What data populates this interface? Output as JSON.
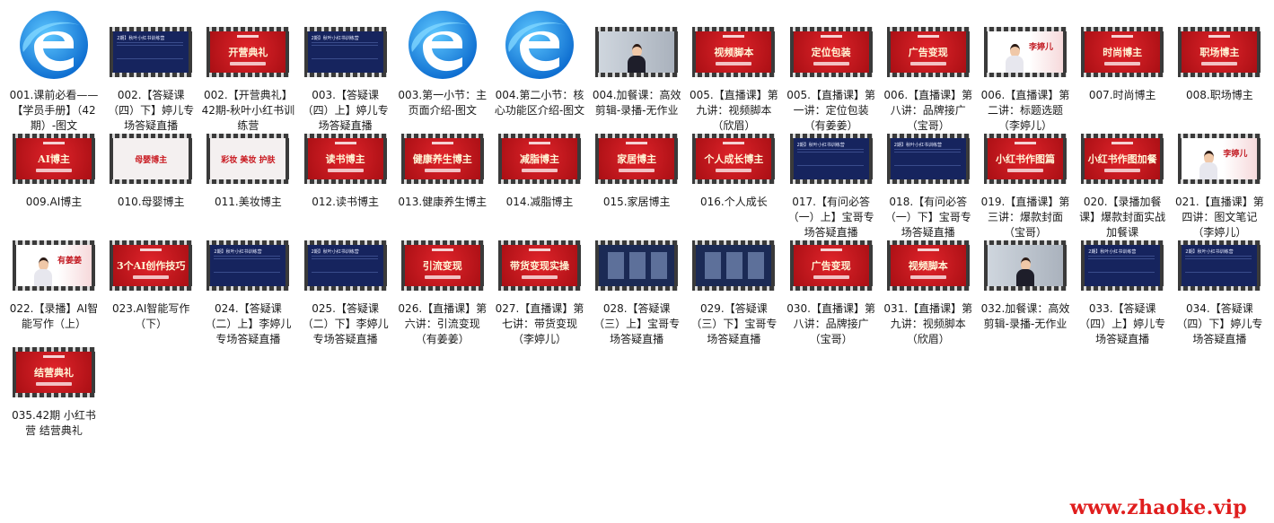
{
  "items": [
    {
      "label": "001.课前必看——【学员手册】（42期）-图文",
      "kind": "edge",
      "thumb": ""
    },
    {
      "label": "002.【答疑课（四）下】婷儿专场答疑直播",
      "kind": "navy",
      "thumb": "2期】秋叶小红书训练营"
    },
    {
      "label": "002.【开营典礼】42期-秋叶小红书训练营",
      "kind": "red",
      "thumb": "开营典礼"
    },
    {
      "label": "003.【答疑课（四）上】婷儿专场答疑直播",
      "kind": "navy",
      "thumb": "2期】秋叶小红书训练营"
    },
    {
      "label": "003.第一小节：主页面介绍-图文",
      "kind": "edge",
      "thumb": ""
    },
    {
      "label": "004.第二小节：核心功能区介绍-图文",
      "kind": "edge",
      "thumb": ""
    },
    {
      "label": "004.加餐课：高效剪辑-录播-无作业",
      "kind": "person",
      "thumb": ""
    },
    {
      "label": "005.【直播课】第九讲：视频脚本（欣眉）",
      "kind": "red",
      "thumb": "视频脚本"
    },
    {
      "label": "005.【直播课】第一讲：定位包装（有姜姜）",
      "kind": "red",
      "thumb": "定位包装"
    },
    {
      "label": "006.【直播课】第八讲：品牌接广（宝哥）",
      "kind": "red",
      "thumb": "广告变现"
    },
    {
      "label": "006.【直播课】第二讲：标题选题（李婷儿）",
      "kind": "pink",
      "thumb": "李婷儿"
    },
    {
      "label": "007.时尚博主",
      "kind": "red",
      "thumb": "时尚博主"
    },
    {
      "label": "008.职场博主",
      "kind": "red",
      "thumb": "职场博主"
    },
    {
      "label": "009.AI博主",
      "kind": "red",
      "thumb": "AI博主"
    },
    {
      "label": "010.母婴博主",
      "kind": "white",
      "thumb": "母婴博主"
    },
    {
      "label": "011.美妆博主",
      "kind": "white",
      "thumb": "彩妆 美妆 护肤"
    },
    {
      "label": "012.读书博主",
      "kind": "red",
      "thumb": "读书博主"
    },
    {
      "label": "013.健康养生博主",
      "kind": "red",
      "thumb": "健康养生博主"
    },
    {
      "label": "014.减脂博主",
      "kind": "red",
      "thumb": "减脂博主"
    },
    {
      "label": "015.家居博主",
      "kind": "red",
      "thumb": "家居博主"
    },
    {
      "label": "016.个人成长",
      "kind": "red",
      "thumb": "个人成长博主"
    },
    {
      "label": "017.【有问必答（一）上】宝哥专场答疑直播",
      "kind": "navy",
      "thumb": "2期】秋叶小红书训练营"
    },
    {
      "label": "018.【有问必答（一）下】宝哥专场答疑直播",
      "kind": "navy",
      "thumb": "2期】秋叶小红书训练营"
    },
    {
      "label": "019.【直播课】第三讲：爆款封面（宝哥）",
      "kind": "red",
      "thumb": "小红书作图篇"
    },
    {
      "label": "020.【录播加餐课】爆款封面实战加餐课",
      "kind": "red",
      "thumb": "小红书作图加餐"
    },
    {
      "label": "021.【直播课】第四讲：图文笔记（李婷儿）",
      "kind": "pink",
      "thumb": "李婷儿"
    },
    {
      "label": "022.【录播】AI智能写作（上）",
      "kind": "pink",
      "thumb": "有姜姜"
    },
    {
      "label": "023.AI智能写作（下）",
      "kind": "red",
      "thumb": "3个AI创作技巧"
    },
    {
      "label": "024.【答疑课（二）上】李婷儿专场答疑直播",
      "kind": "navy",
      "thumb": "2期】秋叶小红书训练营"
    },
    {
      "label": "025.【答疑课（二）下】李婷儿专场答疑直播",
      "kind": "navy",
      "thumb": "2期】秋叶小红书训练营"
    },
    {
      "label": "026.【直播课】第六讲：引流变现（有姜姜）",
      "kind": "red",
      "thumb": "引流变现"
    },
    {
      "label": "027.【直播课】第七讲：带货变现（李婷儿）",
      "kind": "red",
      "thumb": "带货变现实操"
    },
    {
      "label": "028.【答疑课（三）上】宝哥专场答疑直播",
      "kind": "dark",
      "thumb": ""
    },
    {
      "label": "029.【答疑课（三）下】宝哥专场答疑直播",
      "kind": "dark",
      "thumb": ""
    },
    {
      "label": "030.【直播课】第八讲：品牌接广（宝哥）",
      "kind": "red",
      "thumb": "广告变现"
    },
    {
      "label": "031.【直播课】第九讲：视频脚本（欣眉）",
      "kind": "red",
      "thumb": "视频脚本"
    },
    {
      "label": "032.加餐课：高效剪辑-录播-无作业",
      "kind": "person",
      "thumb": ""
    },
    {
      "label": "033.【答疑课（四）上】婷儿专场答疑直播",
      "kind": "navy",
      "thumb": "2期】秋叶小红书训练营"
    },
    {
      "label": "034.【答疑课（四）下】婷儿专场答疑直播",
      "kind": "navy",
      "thumb": "2期】秋叶小红书训练营"
    },
    {
      "label": "035.42期 小红书营 结营典礼",
      "kind": "red",
      "thumb": "结营典礼"
    }
  ],
  "watermark": "www.zhaoke.vip",
  "colors": {
    "red": "#c8161d",
    "navy": "#16245e",
    "watermark": "#e01e1e",
    "edge_blue": "#1a86e0"
  }
}
